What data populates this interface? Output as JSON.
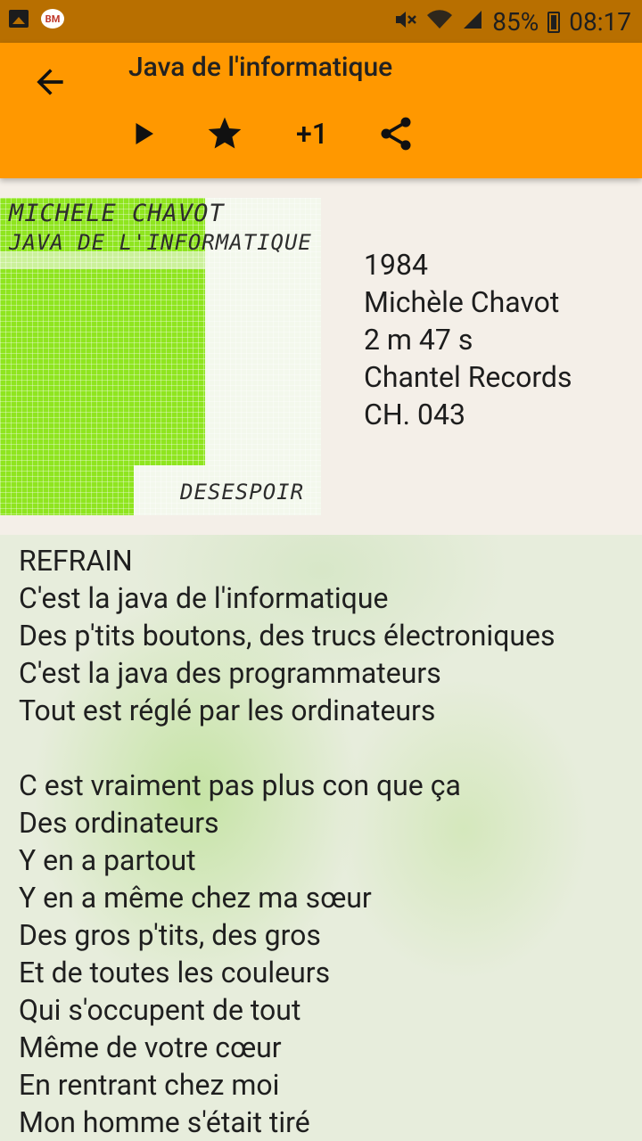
{
  "status_bar": {
    "battery": "85%",
    "time": "08:17",
    "app_badge": "BM",
    "icons": [
      "picture-icon",
      "bm-icon",
      "mute-icon",
      "wifi-icon",
      "signal-icon",
      "battery-charging-icon"
    ]
  },
  "app_bar": {
    "title": "Java de l'informatique",
    "plus_one_label": "+1",
    "icons": [
      "back-arrow-icon",
      "play-icon",
      "star-icon",
      "share-icon"
    ]
  },
  "cover": {
    "artist_text": "MICHELE CHAVOT",
    "title_text": "JAVA DE L'INFORMATIQUE",
    "bottom_text": "DESESPOIR"
  },
  "info": {
    "year": "1984",
    "artist": "Michèle Chavot",
    "duration": "2 m 47 s",
    "label": "Chantel Records",
    "catalog": "CH. 043"
  },
  "lyrics": [
    "REFRAIN",
    "C'est la java de l'informatique",
    "Des p'tits boutons, des trucs électroniques",
    "C'est la java des programmateurs",
    "Tout est réglé par les ordinateurs",
    "",
    "C est vraiment pas plus con que ça",
    "Des ordinateurs",
    "Y en a partout",
    "Y en a même chez ma sœur",
    "Des gros p'tits, des gros",
    "Et de toutes les couleurs",
    "Qui s'occupent de tout",
    "Même de votre cœur",
    "En rentrant chez moi",
    "Mon homme s'était tiré"
  ]
}
